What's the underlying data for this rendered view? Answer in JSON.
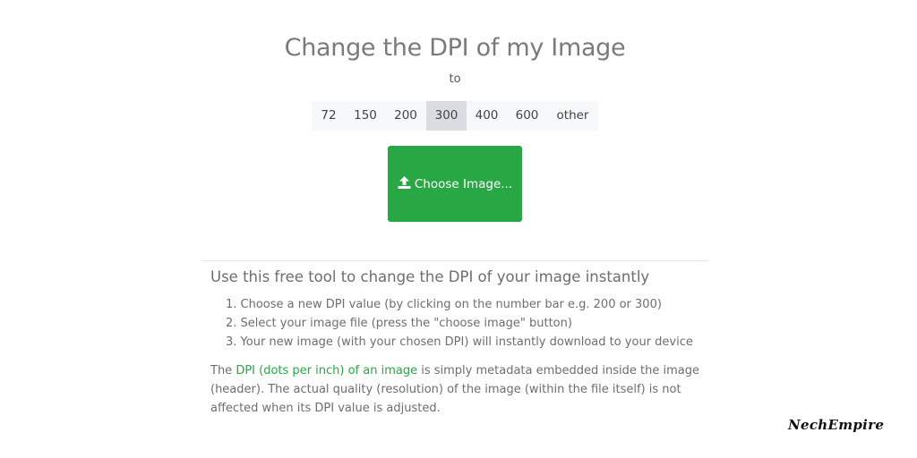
{
  "header": {
    "title": "Change the DPI of my Image",
    "to_label": "to"
  },
  "dpi_options": [
    {
      "label": "72",
      "selected": false
    },
    {
      "label": "150",
      "selected": false
    },
    {
      "label": "200",
      "selected": false
    },
    {
      "label": "300",
      "selected": true
    },
    {
      "label": "400",
      "selected": false
    },
    {
      "label": "600",
      "selected": false
    },
    {
      "label": "other",
      "selected": false
    }
  ],
  "upload": {
    "button_label": "Choose Image...",
    "icon": "upload-icon"
  },
  "info": {
    "subtitle": "Use this free tool to change the DPI of your image instantly",
    "steps": [
      "1. Choose a new DPI value (by clicking on the number bar e.g. 200 or 300)",
      "2. Select your image file (press the \"choose image\" button)",
      "3. Your new image (with your chosen DPI) will instantly download to your device"
    ],
    "paragraph_prefix": "The ",
    "paragraph_link": "DPI (dots per inch) of an image",
    "paragraph_suffix": " is simply metadata embedded inside the image (header). The actual quality (resolution) of the image (within the file itself) is not affected when its DPI value is adjusted."
  },
  "watermark": "NechEmpire",
  "colors": {
    "accent": "#28a745",
    "selected_bg": "#d9dde2",
    "bar_bg": "#f7f8f9"
  }
}
